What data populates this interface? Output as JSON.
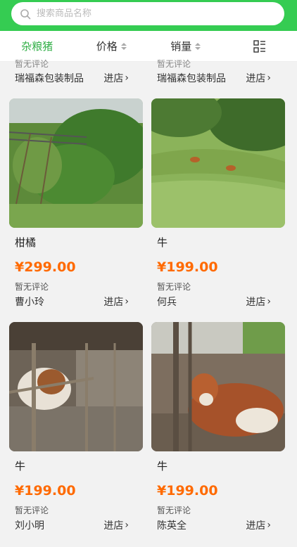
{
  "search": {
    "placeholder": "搜索商品名称"
  },
  "filters": [
    {
      "label": "杂粮猪",
      "active": true
    },
    {
      "label": "价格"
    },
    {
      "label": "销量"
    }
  ],
  "top_row": [
    {
      "review": "暂无评论",
      "shop": "瑞福森包装制品",
      "enter": "进店"
    },
    {
      "review": "暂无评论",
      "shop": "瑞福森包装制品",
      "enter": "进店"
    }
  ],
  "products": [
    {
      "title": "柑橘",
      "price": "¥299.00",
      "review": "暂无评论",
      "seller": "曹小玲",
      "enter": "进店"
    },
    {
      "title": "牛",
      "price": "¥199.00",
      "review": "暂无评论",
      "seller": "何兵",
      "enter": "进店"
    },
    {
      "title": "牛",
      "price": "¥199.00",
      "review": "暂无评论",
      "seller": "刘小明",
      "enter": "进店"
    },
    {
      "title": "牛",
      "price": "¥199.00",
      "review": "暂无评论",
      "seller": "陈英全",
      "enter": "进店"
    }
  ],
  "colors": {
    "accent": "#35cc52",
    "price": "#ff6a00",
    "active_filter": "#35b04a"
  }
}
